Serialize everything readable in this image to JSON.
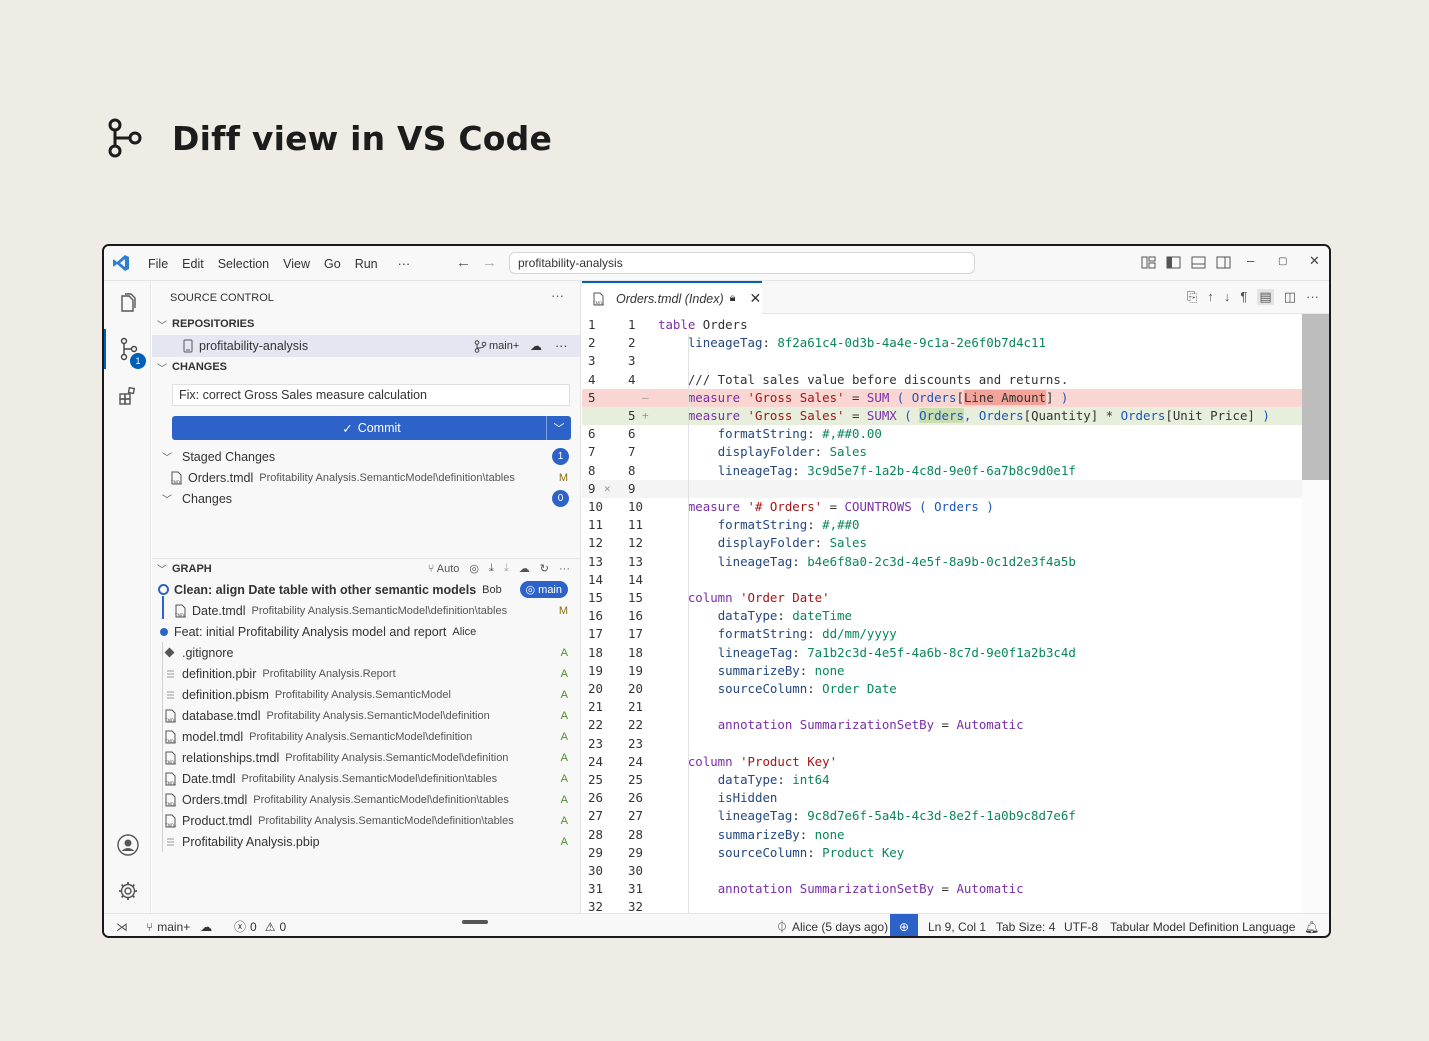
{
  "heading": {
    "title": "Diff view in VS Code",
    "icon": "source-control-icon"
  },
  "titlebar": {
    "menu": [
      "File",
      "Edit",
      "Selection",
      "View",
      "Go",
      "Run",
      "···"
    ],
    "search": "profitability-analysis"
  },
  "activity": {
    "scm_badge": "1"
  },
  "sidebar": {
    "title": "SOURCE CONTROL",
    "repositories_label": "REPOSITORIES",
    "repo_name": "profitability-analysis",
    "repo_branch": "main+",
    "changes_label": "CHANGES",
    "commit_message": "Fix: correct Gross Sales measure calculation",
    "commit_button": "Commit",
    "staged_label": "Staged Changes",
    "staged_count": "1",
    "staged_file": {
      "name": "Orders.tmdl",
      "path": "Profitability Analysis.SemanticModel\\definition\\tables",
      "status": "M"
    },
    "changes_group_label": "Changes",
    "changes_count": "0",
    "graph_label": "GRAPH",
    "graph_auto": "Auto",
    "commits": [
      {
        "message": "Clean: align Date table with other semantic models",
        "author": "Bob",
        "branch": "main",
        "files": [
          {
            "name": "Date.tmdl",
            "path": "Profitability Analysis.SemanticModel\\definition\\tables",
            "status": "M"
          }
        ]
      },
      {
        "message": "Feat: initial Profitability Analysis model and report",
        "author": "Alice",
        "files": [
          {
            "name": ".gitignore",
            "path": "",
            "status": "A"
          },
          {
            "name": "definition.pbir",
            "path": "Profitability Analysis.Report",
            "status": "A"
          },
          {
            "name": "definition.pbism",
            "path": "Profitability Analysis.SemanticModel",
            "status": "A"
          },
          {
            "name": "database.tmdl",
            "path": "Profitability Analysis.SemanticModel\\definition",
            "status": "A"
          },
          {
            "name": "model.tmdl",
            "path": "Profitability Analysis.SemanticModel\\definition",
            "status": "A"
          },
          {
            "name": "relationships.tmdl",
            "path": "Profitability Analysis.SemanticModel\\definition",
            "status": "A"
          },
          {
            "name": "Date.tmdl",
            "path": "Profitability Analysis.SemanticModel\\definition\\tables",
            "status": "A"
          },
          {
            "name": "Orders.tmdl",
            "path": "Profitability Analysis.SemanticModel\\definition\\tables",
            "status": "A"
          },
          {
            "name": "Product.tmdl",
            "path": "Profitability Analysis.SemanticModel\\definition\\tables",
            "status": "A"
          },
          {
            "name": "Profitability Analysis.pbip",
            "path": "",
            "status": "A"
          }
        ]
      }
    ]
  },
  "editor": {
    "tab_title": "Orders.tmdl (Index)",
    "lines": [
      {
        "l": "1",
        "r": "1",
        "text": "table Orders"
      },
      {
        "l": "2",
        "r": "2",
        "text": "    lineageTag: 8f2a61c4-0d3b-4a4e-9c1a-2e6f0b7d4c11"
      },
      {
        "l": "3",
        "r": "3",
        "text": ""
      },
      {
        "l": "4",
        "r": "4",
        "text": "    /// Total sales value before discounts and returns."
      },
      {
        "l": "5",
        "r": "",
        "text": "    measure 'Gross Sales' = SUM ( Orders[Line Amount] )",
        "kind": "del"
      },
      {
        "l": "",
        "r": "5",
        "text": "    measure 'Gross Sales' = SUMX ( Orders, Orders[Quantity] * Orders[Unit Price] )",
        "kind": "add"
      },
      {
        "l": "6",
        "r": "6",
        "text": "        formatString: #,##0.00"
      },
      {
        "l": "7",
        "r": "7",
        "text": "        displayFolder: Sales"
      },
      {
        "l": "8",
        "r": "8",
        "text": "        lineageTag: 3c9d5e7f-1a2b-4c8d-9e0f-6a7b8c9d0e1f"
      },
      {
        "l": "9",
        "r": "9",
        "text": "",
        "kind": "cur"
      },
      {
        "l": "10",
        "r": "10",
        "text": "    measure '# Orders' = COUNTROWS ( Orders )"
      },
      {
        "l": "11",
        "r": "11",
        "text": "        formatString: #,##0"
      },
      {
        "l": "12",
        "r": "12",
        "text": "        displayFolder: Sales"
      },
      {
        "l": "13",
        "r": "13",
        "text": "        lineageTag: b4e6f8a0-2c3d-4e5f-8a9b-0c1d2e3f4a5b"
      },
      {
        "l": "14",
        "r": "14",
        "text": ""
      },
      {
        "l": "15",
        "r": "15",
        "text": "    column 'Order Date'"
      },
      {
        "l": "16",
        "r": "16",
        "text": "        dataType: dateTime"
      },
      {
        "l": "17",
        "r": "17",
        "text": "        formatString: dd/mm/yyyy"
      },
      {
        "l": "18",
        "r": "18",
        "text": "        lineageTag: 7a1b2c3d-4e5f-4a6b-8c7d-9e0f1a2b3c4d"
      },
      {
        "l": "19",
        "r": "19",
        "text": "        summarizeBy: none"
      },
      {
        "l": "20",
        "r": "20",
        "text": "        sourceColumn: Order Date"
      },
      {
        "l": "21",
        "r": "21",
        "text": ""
      },
      {
        "l": "22",
        "r": "22",
        "text": "        annotation SummarizationSetBy = Automatic"
      },
      {
        "l": "23",
        "r": "23",
        "text": ""
      },
      {
        "l": "24",
        "r": "24",
        "text": "    column 'Product Key'"
      },
      {
        "l": "25",
        "r": "25",
        "text": "        dataType: int64"
      },
      {
        "l": "26",
        "r": "26",
        "text": "        isHidden"
      },
      {
        "l": "27",
        "r": "27",
        "text": "        lineageTag: 9c8d7e6f-5a4b-4c3d-8e2f-1a0b9c8d7e6f"
      },
      {
        "l": "28",
        "r": "28",
        "text": "        summarizeBy: none"
      },
      {
        "l": "29",
        "r": "29",
        "text": "        sourceColumn: Product Key"
      },
      {
        "l": "30",
        "r": "30",
        "text": ""
      },
      {
        "l": "31",
        "r": "31",
        "text": "        annotation SummarizationSetBy = Automatic"
      },
      {
        "l": "32",
        "r": "32",
        "text": ""
      }
    ]
  },
  "statusbar": {
    "branch": "main+",
    "errors": "0",
    "warnings": "0",
    "blame": "Alice (5 days ago)",
    "cursor": "Ln 9, Col 1",
    "tab_size": "Tab Size: 4",
    "encoding": "UTF-8",
    "language": "Tabular Model Definition Language"
  },
  "colors": {
    "accent": "#2d63c8",
    "deleted": "#f9d6d1",
    "added": "#e7efdc",
    "background": "#efebe5"
  }
}
